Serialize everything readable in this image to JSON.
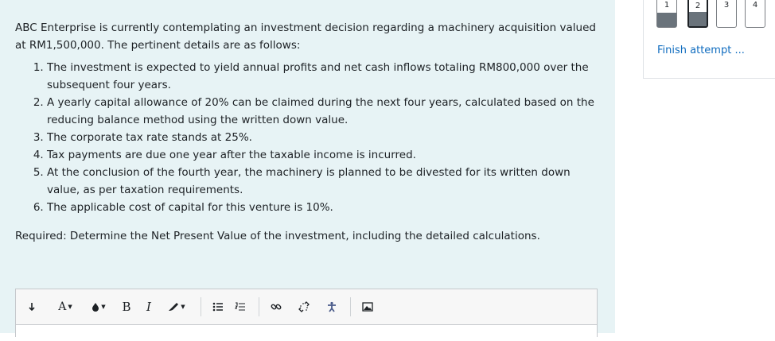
{
  "question": {
    "intro": "ABC Enterprise is currently contemplating an investment decision regarding a machinery acquisition valued at RM1,500,000. The pertinent details are as follows:",
    "items": [
      "The investment is expected to yield annual profits and net cash inflows totaling RM800,000 over the subsequent four years.",
      "A yearly capital allowance of 20% can be claimed during the next four years, calculated based on the reducing balance method using the written down value.",
      "The corporate tax rate stands at 25%.",
      "Tax payments are due one year after the taxable income is incurred.",
      "At the conclusion of the fourth year, the machinery is planned to be divested for its written down value, as per taxation requirements.",
      "The applicable cost of capital for this venture is 10%."
    ],
    "required": "Required: Determine the Net Present Value of the investment, including the detailed calculations."
  },
  "editor": {
    "toolbar": {
      "font_label": "A",
      "bold_label": "B",
      "italic_label": "I"
    }
  },
  "quiz_nav": {
    "buttons": [
      {
        "number": "1",
        "state": "answered"
      },
      {
        "number": "2",
        "state": "current-answered"
      },
      {
        "number": "3",
        "state": "not-answered"
      },
      {
        "number": "4",
        "state": "not-answered"
      }
    ],
    "finish_label": "Finish attempt ..."
  },
  "colors": {
    "question_bg": "#e7f3f5",
    "link": "#0f6cbf",
    "answered_fill": "#6a737b"
  },
  "icons": [
    "collapse-toolbar-icon",
    "font-color-icon",
    "background-color-icon",
    "text-style-icon",
    "unordered-list-icon",
    "ordered-list-icon",
    "link-icon",
    "unlink-icon",
    "accessibility-icon",
    "image-icon"
  ]
}
